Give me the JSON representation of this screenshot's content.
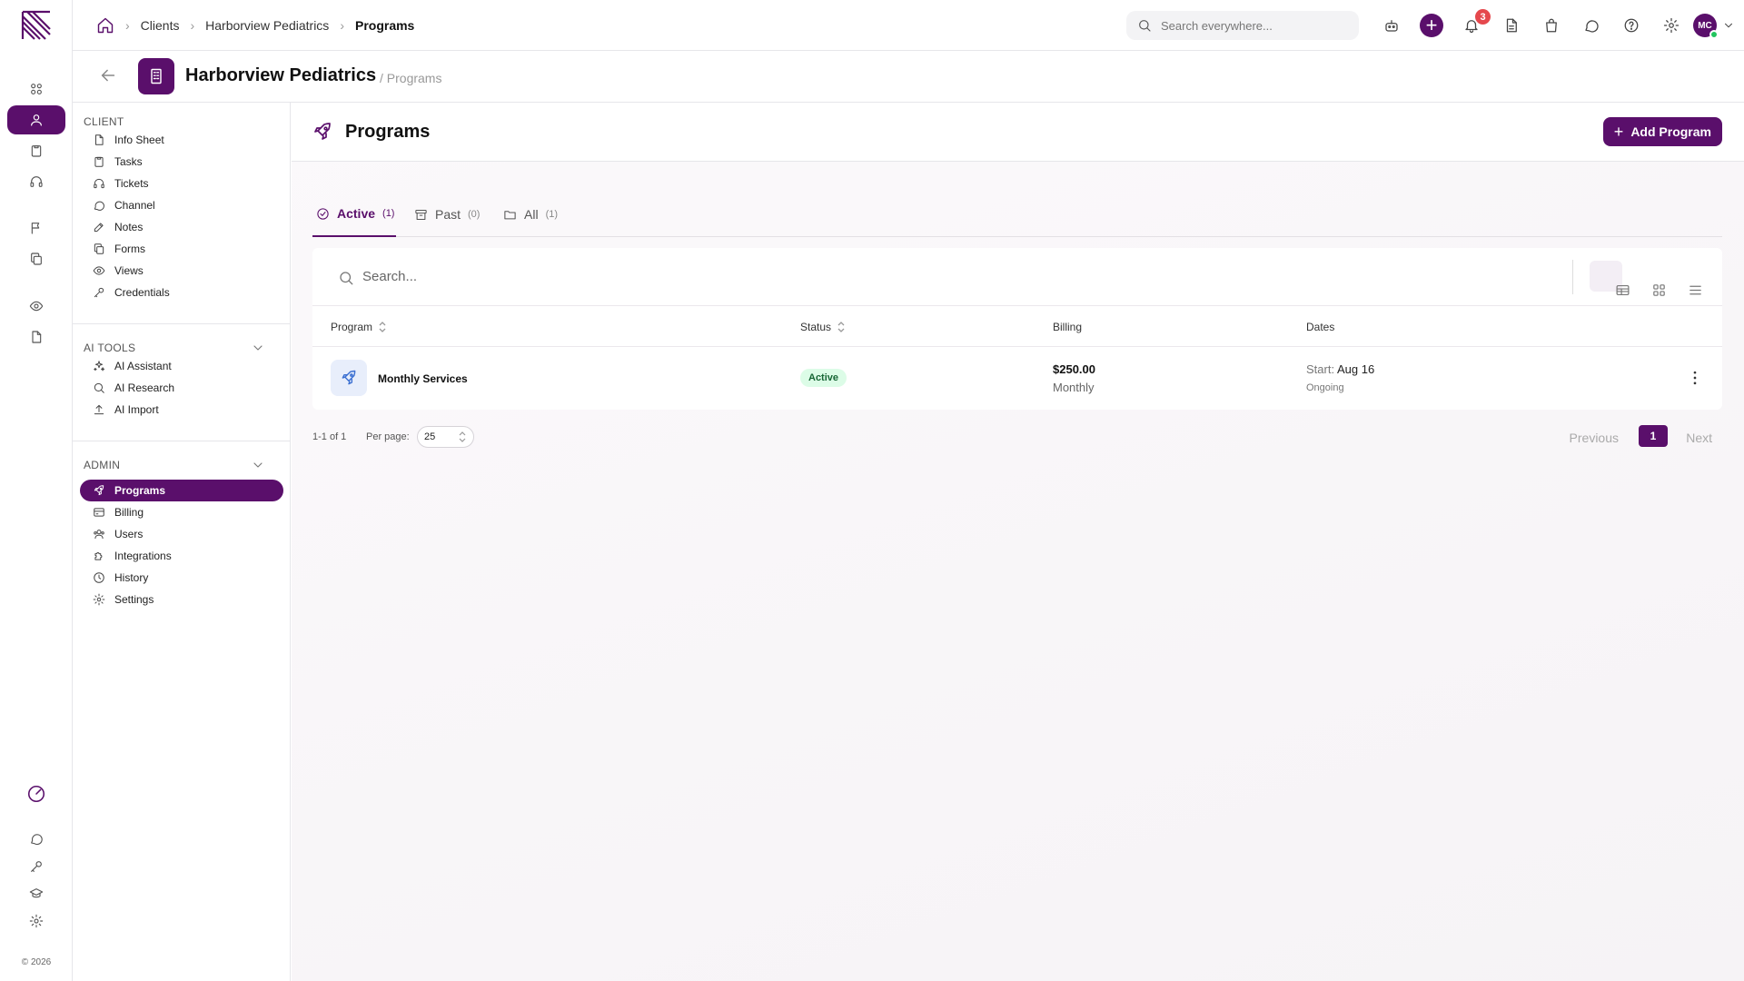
{
  "breadcrumbs": [
    "Clients",
    "Harborview Pediatrics",
    "Programs"
  ],
  "global_search": {
    "placeholder": "Search everywhere..."
  },
  "notifications": {
    "count": "3"
  },
  "user": {
    "initials": "MC"
  },
  "client": {
    "name": "Harborview Pediatrics",
    "section": "/ Programs"
  },
  "sidebar": {
    "client_heading": "CLIENT",
    "client_items": [
      {
        "label": "Info Sheet",
        "icon": "file-icon"
      },
      {
        "label": "Tasks",
        "icon": "clipboard-icon"
      },
      {
        "label": "Tickets",
        "icon": "headset-icon"
      },
      {
        "label": "Channel",
        "icon": "chat-icon"
      },
      {
        "label": "Notes",
        "icon": "edit-icon"
      },
      {
        "label": "Forms",
        "icon": "forms-icon"
      },
      {
        "label": "Views",
        "icon": "eye-icon"
      },
      {
        "label": "Credentials",
        "icon": "key-icon"
      }
    ],
    "ai_heading": "AI TOOLS",
    "ai_items": [
      {
        "label": "AI Assistant",
        "icon": "sparkles-icon"
      },
      {
        "label": "AI Research",
        "icon": "search-icon"
      },
      {
        "label": "AI Import",
        "icon": "upload-icon"
      }
    ],
    "admin_heading": "ADMIN",
    "admin_items": [
      {
        "label": "Programs",
        "icon": "rocket-icon",
        "active": true
      },
      {
        "label": "Billing",
        "icon": "card-icon"
      },
      {
        "label": "Users",
        "icon": "users-icon"
      },
      {
        "label": "Integrations",
        "icon": "puzzle-icon"
      },
      {
        "label": "History",
        "icon": "clock-icon"
      },
      {
        "label": "Settings",
        "icon": "gear-icon"
      }
    ]
  },
  "main": {
    "title": "Programs",
    "add_button": "Add Program",
    "tabs": [
      {
        "label": "Active",
        "count": "(1)",
        "active": true
      },
      {
        "label": "Past",
        "count": "(0)"
      },
      {
        "label": "All",
        "count": "(1)"
      }
    ],
    "search_placeholder": "Search...",
    "columns": [
      "Program",
      "Status",
      "Billing",
      "Dates"
    ],
    "rows": [
      {
        "program": "Monthly Services",
        "status": "Active",
        "amount": "$250.00",
        "frequency": "Monthly",
        "start_label": "Start:",
        "start_date": "Aug 16",
        "end": "Ongoing"
      }
    ],
    "pagination": {
      "range": "1-1 of 1",
      "per_page_label": "Per page:",
      "per_page": "25",
      "previous": "Previous",
      "page": "1",
      "next": "Next"
    }
  },
  "footer": {
    "copyright": "© 2026"
  },
  "colors": {
    "brand": "#5a0f6b",
    "active_status_bg": "#dcfce7",
    "badge": "#e5484d"
  }
}
